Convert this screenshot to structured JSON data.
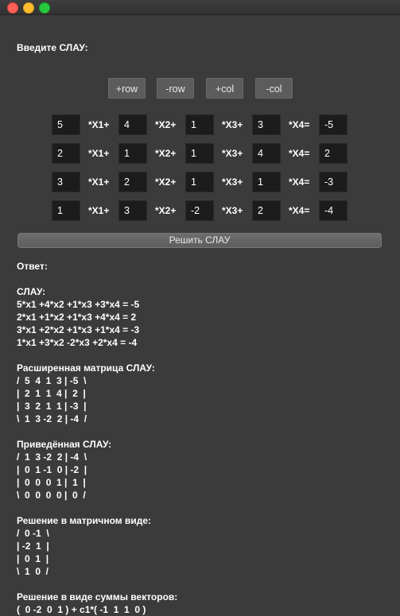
{
  "window": {
    "controls": [
      "close",
      "minimize",
      "zoom"
    ]
  },
  "prompt": "Введите СЛАУ:",
  "controls": [
    {
      "id": "add-row",
      "label": "+row"
    },
    {
      "id": "remove-row",
      "label": "-row"
    },
    {
      "id": "add-col",
      "label": "+col"
    },
    {
      "id": "remove-col",
      "label": "-col"
    }
  ],
  "operators": [
    "*X1+",
    "*X2+",
    "*X3+",
    "*X4="
  ],
  "rows": [
    [
      "5",
      "4",
      "1",
      "3",
      "-5"
    ],
    [
      "2",
      "1",
      "1",
      "4",
      "2"
    ],
    [
      "3",
      "2",
      "1",
      "1",
      "-3"
    ],
    [
      "1",
      "3",
      "-2",
      "2",
      "-4"
    ]
  ],
  "solve_button": "Решить СЛАУ",
  "answer": {
    "header": "Ответ:",
    "sections": [
      {
        "title": "СЛАУ:",
        "lines": [
          "5*x1 +4*x2 +1*x3 +3*x4 = -5",
          "2*x1 +1*x2 +1*x3 +4*x4 = 2",
          "3*x1 +2*x2 +1*x3 +1*x4 = -3",
          "1*x1 +3*x2 -2*x3 +2*x4 = -4"
        ]
      },
      {
        "title": "Расширенная матрица СЛАУ:",
        "lines": [
          "/  5  4  1  3 | -5  \\",
          "|  2  1  1  4 |  2  |",
          "|  3  2  1  1 | -3  |",
          "\\  1  3 -2  2 | -4  /"
        ]
      },
      {
        "title": "Приведённая СЛАУ:",
        "lines": [
          "/  1  3 -2  2 | -4  \\",
          "|  0  1 -1  0 | -2  |",
          "|  0  0  0  1 |  1  |",
          "\\  0  0  0  0 |  0  /"
        ]
      },
      {
        "title": "Решение в матричном виде:",
        "lines": [
          "/  0 -1  \\",
          "| -2  1  |",
          "|  0  1  |",
          "\\  1  0  /"
        ]
      },
      {
        "title": "Решение в виде суммы векторов:",
        "lines": [
          "(  0 -2  0  1 ) + c1*( -1  1  1  0 )"
        ]
      }
    ]
  }
}
